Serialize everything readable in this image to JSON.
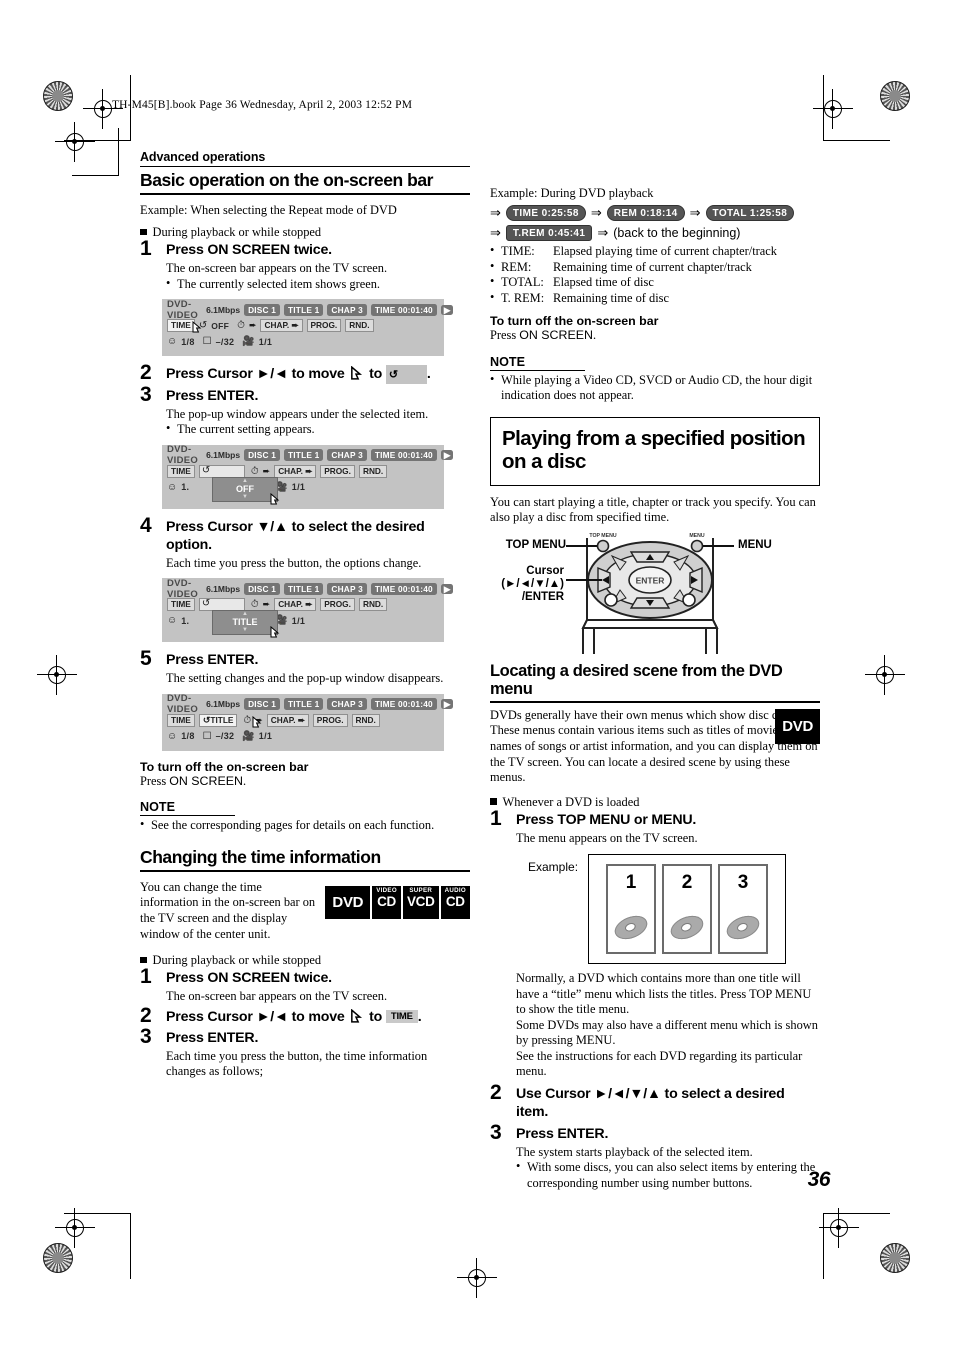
{
  "file_header": "TH-M45[B].book  Page 36  Wednesday, April 2, 2003  12:52 PM",
  "page_number": "36",
  "section_label": "Advanced operations",
  "left_column": {
    "heading": "Basic operation on the on-screen bar",
    "example_line": "Example: When selecting the Repeat mode of DVD",
    "condition": "During playback or while stopped",
    "steps": [
      {
        "num": "1",
        "title": "Press ON SCREEN twice.",
        "sub": "The on-screen bar appears on the TV screen.",
        "bullet": "The currently selected item shows green."
      },
      {
        "num": "2",
        "title_pre": "Press Cursor ►/◄ to move",
        "title_mid": "to",
        "title_post": "."
      },
      {
        "num": "3",
        "title": "Press ENTER.",
        "sub": "The pop-up window appears under the selected item.",
        "bullet": "The current setting appears."
      },
      {
        "num": "4",
        "title": "Press Cursor ▼/▲ to select the desired option.",
        "sub": "Each time you press the button, the options change."
      },
      {
        "num": "5",
        "title": "Press ENTER.",
        "sub": "The setting changes and the pop-up window disappears."
      }
    ],
    "turn_off_title": "To turn off the on-screen bar",
    "turn_off_body_pre": "Press ",
    "turn_off_body_key": "ON SCREEN",
    "turn_off_body_post": ".",
    "note_title": "NOTE",
    "note_bullet": "See the corresponding pages for details on each function.",
    "time_heading": "Changing the time information",
    "time_body": "You can change the time information in the on-screen bar on the TV screen and the display window of the center unit.",
    "time_condition": "During playback or while stopped",
    "time_steps": [
      {
        "num": "1",
        "title": "Press ON SCREEN twice.",
        "sub": "The on-screen bar appears on the TV screen."
      },
      {
        "num": "2",
        "title_pre": "Press Cursor ►/◄ to move",
        "title_mid": "to",
        "title_post": "."
      },
      {
        "num": "3",
        "title": "Press ENTER.",
        "sub": "Each time you press the button, the time information changes as follows;"
      }
    ],
    "badges": [
      {
        "top": "",
        "main": "DVD"
      },
      {
        "top": "VIDEO",
        "main": "CD"
      },
      {
        "top": "SUPER",
        "main": "VCD"
      },
      {
        "top": "AUDIO",
        "main": "CD"
      }
    ]
  },
  "osb": {
    "disc_type": "DVD-VIDEO",
    "bitrate": "6.1Mbps",
    "chips": [
      "DISC 1",
      "TITLE 1",
      "CHAP  3",
      "TIME 00:01:40"
    ],
    "play_arrow": "▶",
    "row2": {
      "time": "TIME",
      "repeat_icon": "repeat-icon",
      "repeat_value_off": "OFF",
      "repeat_value_title": "TITLE",
      "clock": "clock-icon",
      "chap": "CHAP.",
      "prog": "PROG.",
      "rnd": "RND."
    },
    "row3": {
      "audio": "1/8",
      "subtitle": "–/32",
      "angle": "1/1",
      "audio_icon": "audio-icon",
      "subtitle_icon": "subtitle-icon",
      "angle_icon": "angle-icon"
    },
    "popup_off": "OFF",
    "popup_title": "TITLE"
  },
  "right_column": {
    "example_label": "Example: During DVD playback",
    "time_chain_1": [
      "TIME  0:25:58",
      "REM  0:18:14",
      "TOTAL  1:25:58"
    ],
    "time_chain_2": [
      "T.REM 0:45:41"
    ],
    "time_chain_2_tail": "(back to the beginning)",
    "time_defs": [
      {
        "term": "TIME:",
        "def": "Elapsed playing time of current chapter/track"
      },
      {
        "term": "REM:",
        "def": "Remaining time of current chapter/track"
      },
      {
        "term": "TOTAL:",
        "def": "Elapsed time of disc"
      },
      {
        "term": "T. REM:",
        "def": "Remaining time of disc"
      }
    ],
    "turn_off_title": "To turn off the on-screen bar",
    "turn_off_body_pre": "Press ",
    "turn_off_body_key": "ON SCREEN",
    "turn_off_body_post": ".",
    "note_title": "NOTE",
    "note_bullet": "While playing a Video CD, SVCD or Audio CD, the hour digit indication does not appear.",
    "boxed_heading": "Playing from a specified position on a disc",
    "intro": "You can start playing a title, chapter or track you specify. You can also play a disc from specified time.",
    "remote": {
      "top_menu_label": "TOP MENU",
      "menu_label": "MENU",
      "cursor_label_1": "Cursor",
      "cursor_label_2": "(►/◄/▼/▲)",
      "cursor_label_3": "/ENTER",
      "enter_text": "ENTER",
      "top_menu_btn": "TOP MENU",
      "menu_btn": "MENU"
    },
    "dvd_menu_heading": "Locating a desired scene from the DVD menu",
    "dvd_menu_body": "DVDs generally have their own menus which show disc contents. These menus contain various items such as titles of movies, names of songs or artist information, and you can display them on the TV screen. You can locate a desired scene by using these menus.",
    "dvd_badge": "DVD",
    "condition": "Whenever a DVD is loaded",
    "steps": [
      {
        "num": "1",
        "title": "Press TOP MENU or MENU.",
        "sub": "The menu appears on the TV screen."
      },
      {
        "num": "2",
        "title": "Use Cursor ►/◄/▼/▲ to select a desired item."
      },
      {
        "num": "3",
        "title": "Press ENTER.",
        "sub": "The system starts playback of the selected item.",
        "bullet": "With some discs, you can also select items by entering the corresponding number using number buttons."
      }
    ],
    "example_label_2": "Example:",
    "disc_cards": [
      "1",
      "2",
      "3"
    ],
    "after_example": [
      "Normally, a DVD which contains more than one title will have a “title” menu which lists the titles. Press TOP MENU to show the title menu.",
      "Some DVDs may also have a different menu which is shown by pressing MENU.",
      "See the instructions for each DVD regarding its particular menu."
    ]
  }
}
